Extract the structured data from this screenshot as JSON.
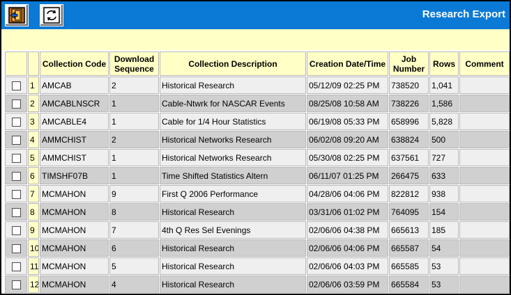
{
  "app": {
    "title": "Research Export"
  },
  "toolbar": {
    "exit_icon": "exit-door-icon",
    "refresh_icon": "refresh-icon"
  },
  "colors": {
    "titlebar": "#0a7ad6",
    "header_bg": "#ffffc6",
    "row_light": "#efefef",
    "row_dark": "#d0d0d0"
  },
  "table": {
    "headers": {
      "collection_code": "Collection Code",
      "download_sequence": "Download Sequence",
      "collection_description": "Collection Description",
      "creation_datetime": "Creation Date/Time",
      "job_number": "Job Number",
      "rows": "Rows",
      "comment": "Comment"
    },
    "rows": [
      {
        "num": "1",
        "code": "AMCAB",
        "seq": "2",
        "desc": "Historical Research",
        "created": "05/12/09 02:25 PM",
        "job": "738520",
        "rows": "1,041",
        "comment": ""
      },
      {
        "num": "2",
        "code": "AMCABLNSCR",
        "seq": "1",
        "desc": "Cable-Ntwrk for NASCAR Events",
        "created": "08/25/08 10:58 AM",
        "job": "738226",
        "rows": "1,586",
        "comment": ""
      },
      {
        "num": "3",
        "code": "AMCABLE4",
        "seq": "1",
        "desc": "Cable for 1/4 Hour Statistics",
        "created": "06/19/08 05:33 PM",
        "job": "658996",
        "rows": "5,828",
        "comment": ""
      },
      {
        "num": "4",
        "code": "AMMCHIST",
        "seq": "2",
        "desc": "Historical Networks Research",
        "created": "06/02/08 09:20 AM",
        "job": "638824",
        "rows": "500",
        "comment": ""
      },
      {
        "num": "5",
        "code": "AMMCHIST",
        "seq": "1",
        "desc": "Historical Networks Research",
        "created": "05/30/08 02:25 PM",
        "job": "637561",
        "rows": "727",
        "comment": ""
      },
      {
        "num": "6",
        "code": "TIMSHF07B",
        "seq": "1",
        "desc": "Time Shifted Statistics Altern",
        "created": "06/11/07 01:25 PM",
        "job": "266475",
        "rows": "633",
        "comment": ""
      },
      {
        "num": "7",
        "code": "MCMAHON",
        "seq": "9",
        "desc": "First Q 2006 Performance",
        "created": "04/28/06 04:06 PM",
        "job": "822812",
        "rows": "938",
        "comment": ""
      },
      {
        "num": "8",
        "code": "MCMAHON",
        "seq": "8",
        "desc": "Historical Research",
        "created": "03/31/06 01:02 PM",
        "job": "764095",
        "rows": "154",
        "comment": ""
      },
      {
        "num": "9",
        "code": "MCMAHON",
        "seq": "7",
        "desc": "4th Q Res Sel Evenings",
        "created": "02/06/06 04:38 PM",
        "job": "665613",
        "rows": "185",
        "comment": ""
      },
      {
        "num": "10",
        "code": "MCMAHON",
        "seq": "6",
        "desc": "Historical Research",
        "created": "02/06/06 04:06 PM",
        "job": "665587",
        "rows": "54",
        "comment": ""
      },
      {
        "num": "11",
        "code": "MCMAHON",
        "seq": "5",
        "desc": "Historical Research",
        "created": "02/06/06 04:03 PM",
        "job": "665585",
        "rows": "53",
        "comment": ""
      },
      {
        "num": "12",
        "code": "MCMAHON",
        "seq": "4",
        "desc": "Historical Research",
        "created": "02/06/06 03:59 PM",
        "job": "665584",
        "rows": "53",
        "comment": ""
      }
    ]
  }
}
